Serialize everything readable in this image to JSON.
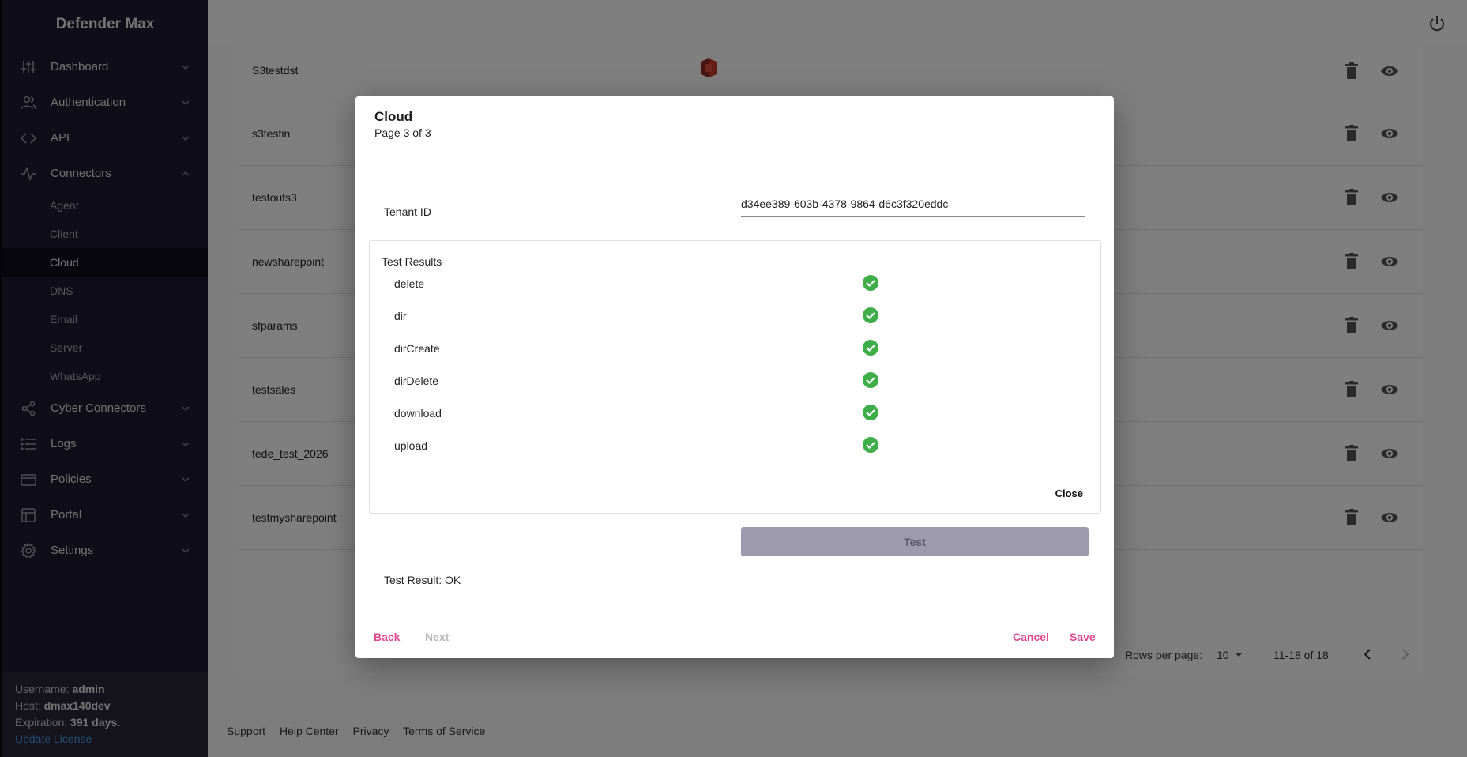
{
  "app": {
    "title": "Defender Max"
  },
  "sidebar": {
    "items": [
      {
        "label": "Dashboard",
        "icon": "sliders-icon"
      },
      {
        "label": "Authentication",
        "icon": "users-icon"
      },
      {
        "label": "API",
        "icon": "code-icon"
      },
      {
        "label": "Connectors",
        "icon": "activity-icon"
      }
    ],
    "connectors_sub": [
      "Agent",
      "Client",
      "Cloud",
      "DNS",
      "Email",
      "Server",
      "WhatsApp"
    ],
    "active_sub": "Cloud",
    "items_after": [
      {
        "label": "Cyber Connectors",
        "icon": "share-icon"
      },
      {
        "label": "Logs",
        "icon": "list-icon"
      },
      {
        "label": "Policies",
        "icon": "card-icon"
      },
      {
        "label": "Portal",
        "icon": "layout-icon"
      },
      {
        "label": "Settings",
        "icon": "gear-icon"
      }
    ]
  },
  "license": {
    "username_label": "Username:",
    "username": "admin",
    "host_label": "Host:",
    "host": "dmax140dev",
    "expiration_label": "Expiration:",
    "expiration": "391 days.",
    "update_link": "Update License"
  },
  "table": {
    "rows": [
      "S3testdst",
      "s3testin",
      "testouts3",
      "newsharepoint",
      "sfparams",
      "testsales",
      "fede_test_2026",
      "testmysharepoint"
    ],
    "rows_per_page_label": "Rows per page:",
    "rows_per_page": "10",
    "range": "11-18 of 18"
  },
  "footer": {
    "links": [
      "Support",
      "Help Center",
      "Privacy",
      "Terms of Service"
    ]
  },
  "modal": {
    "title": "Cloud",
    "subtitle": "Page 3 of 3",
    "tenant_label": "Tenant ID",
    "tenant_value": "d34ee389-603b-4378-9864-d6c3f320eddc",
    "results_title": "Test Results",
    "results": [
      "delete",
      "dir",
      "dirCreate",
      "dirDelete",
      "download",
      "upload"
    ],
    "close_label": "Close",
    "test_label": "Test",
    "test_result": "Test Result: OK",
    "back_label": "Back",
    "next_label": "Next",
    "cancel_label": "Cancel",
    "save_label": "Save",
    "colors": {
      "accent": "#e0488f",
      "success": "#3fae49"
    }
  }
}
